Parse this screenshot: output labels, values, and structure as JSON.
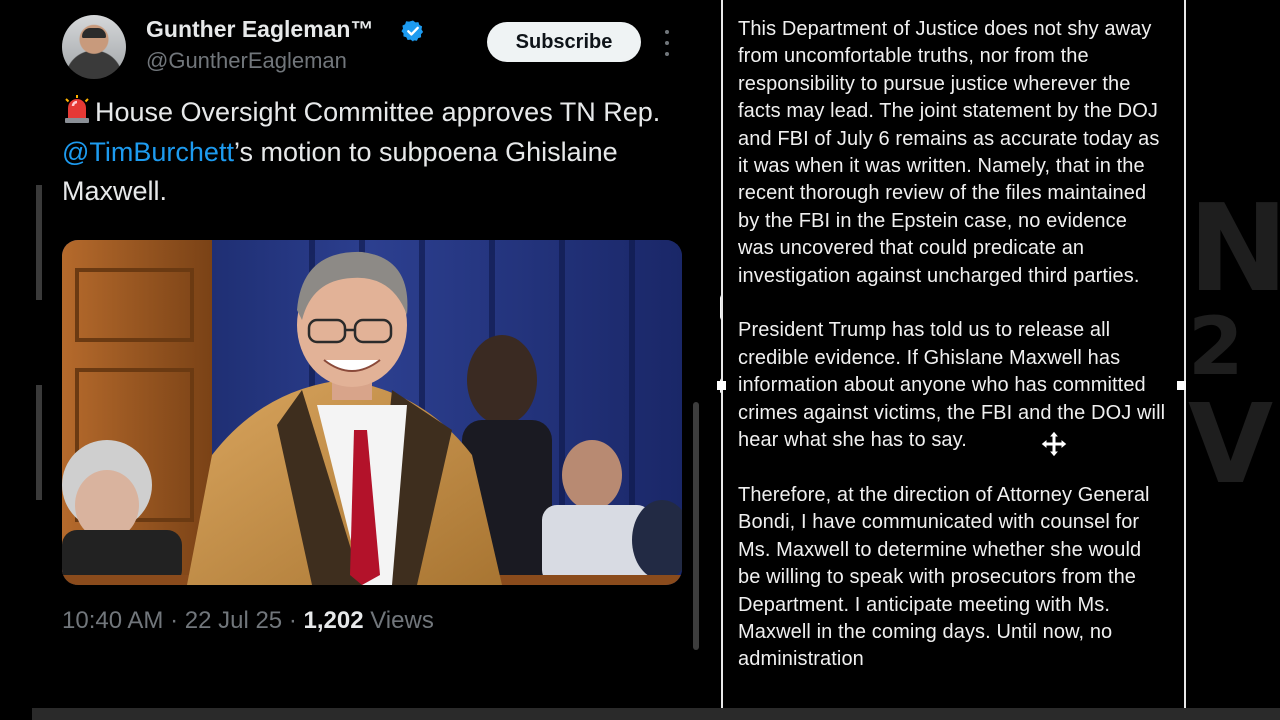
{
  "tweet": {
    "display_name": "Gunther Eagleman™",
    "handle": "@GuntherEagleman",
    "subscribe_label": "Subscribe",
    "text_part1": "House Oversight Committee approves TN Rep. ",
    "mention": "@TimBurchett",
    "text_part2": "’s motion to subpoena Ghislaine Maxwell.",
    "time": "10:40 AM",
    "date": "22 Jul 25",
    "views_count": "1,202",
    "views_label": "Views",
    "icons": [
      "verified-badge-icon",
      "more-options-icon",
      "siren-emoji-icon"
    ]
  },
  "document": {
    "paragraphs": [
      "This Department of Justice does not shy away from uncomfortable truths, nor from the responsibility to pursue justice wherever the facts may lead.  The joint statement by the DOJ and FBI of July 6 remains as accurate today as it was when it was written.  Namely, that in the recent thorough review of the files maintained by the FBI in the Epstein case, no evidence was uncovered that could predicate an investigation against uncharged third parties.",
      "President Trump has told us to release all credible evidence. If Ghislane Maxwell has information about anyone who has committed crimes against victims, the FBI and the DOJ will hear what she has to say.",
      "Therefore, at the direction of Attorney General Bondi, I have communicated with counsel for Ms. Maxwell to determine whether she would be willing to speak with prosecutors from the Department.  I anticipate meeting with Ms. Maxwell in the coming days.  Until now, no administration"
    ]
  },
  "colors": {
    "background": "#000000",
    "mention_blue": "#1d9bf0",
    "muted_gray": "#71767b",
    "verified_blue": "#1d9bf0"
  }
}
